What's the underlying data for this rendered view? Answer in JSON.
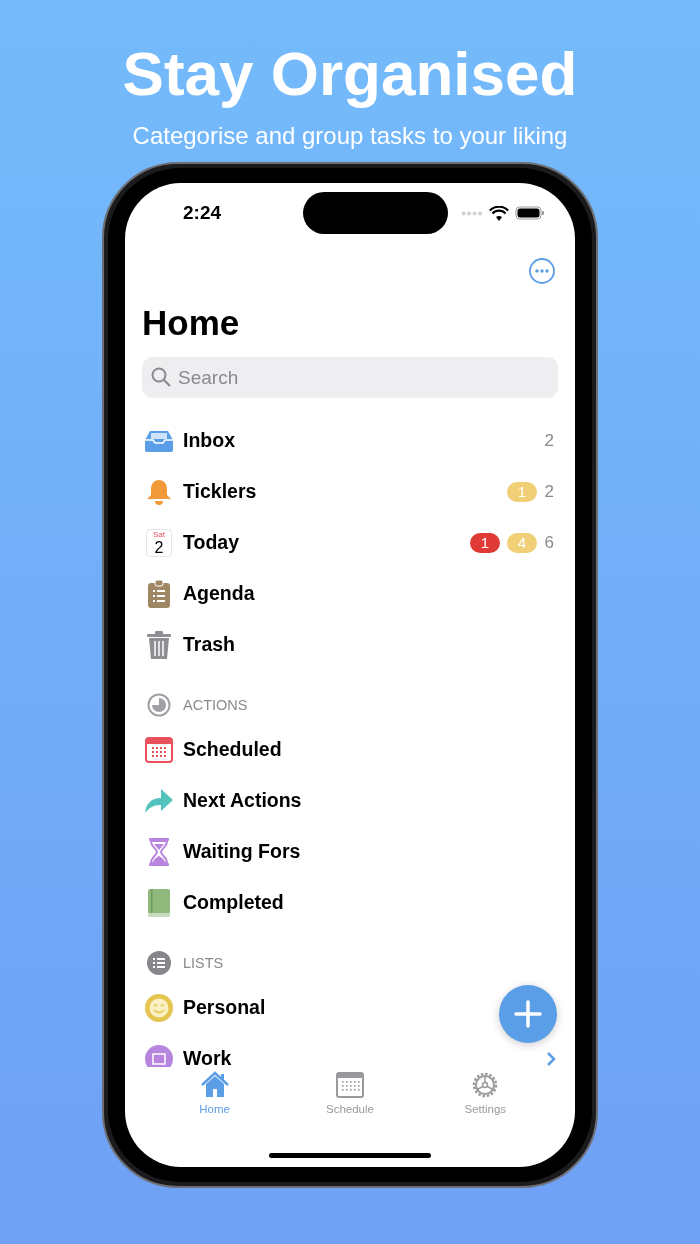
{
  "header": {
    "title": "Stay Organised",
    "subtitle": "Categorise and group tasks to your liking"
  },
  "status_bar": {
    "time": "2:24"
  },
  "page_title": "Home",
  "search": {
    "placeholder": "Search"
  },
  "items": [
    {
      "kind": "inbox",
      "label": "Inbox",
      "count": "2"
    },
    {
      "kind": "bell",
      "label": "Ticklers",
      "badges": [
        {
          "text": "1",
          "color": "#f0cf76"
        }
      ],
      "count": "2"
    },
    {
      "kind": "date",
      "label": "Today",
      "date_day": "Sat",
      "date_num": "2",
      "badges": [
        {
          "text": "1",
          "color": "#e03a36"
        },
        {
          "text": "4",
          "color": "#f0cf76"
        }
      ],
      "count": "6"
    },
    {
      "kind": "clipboard",
      "label": "Agenda"
    },
    {
      "kind": "trash",
      "label": "Trash"
    }
  ],
  "sections": [
    {
      "kind": "clock",
      "title": "ACTIONS",
      "items": [
        {
          "kind": "calendar",
          "label": "Scheduled"
        },
        {
          "kind": "arrow",
          "label": "Next Actions"
        },
        {
          "kind": "hourglass",
          "label": "Waiting Fors"
        },
        {
          "kind": "book",
          "label": "Completed"
        }
      ]
    },
    {
      "kind": "list",
      "title": "LISTS",
      "items": [
        {
          "kind": "smiley",
          "label": "Personal"
        },
        {
          "kind": "folder",
          "label": "Work",
          "expandable": true
        }
      ]
    }
  ],
  "tabs": [
    {
      "kind": "home",
      "label": "Home",
      "selected": true
    },
    {
      "kind": "schedule",
      "label": "Schedule",
      "selected": false
    },
    {
      "kind": "settings",
      "label": "Settings",
      "selected": false
    }
  ]
}
